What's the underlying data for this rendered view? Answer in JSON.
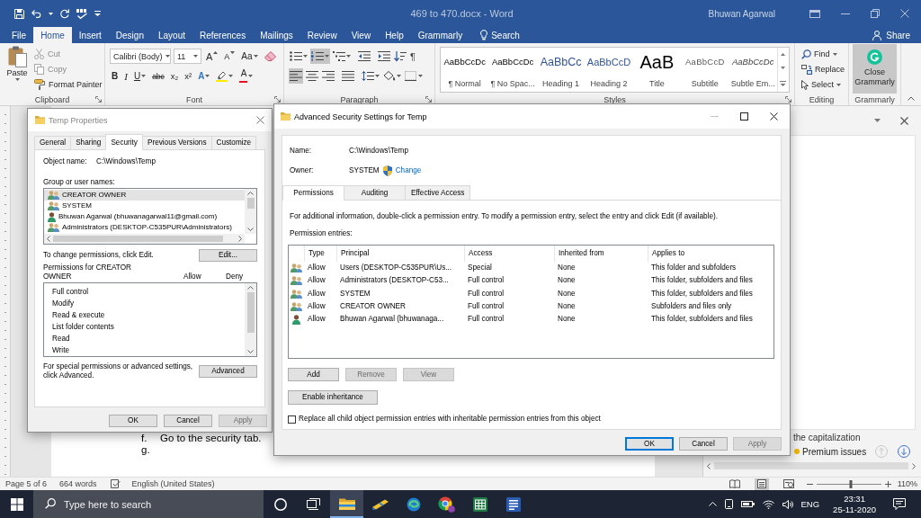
{
  "word": {
    "title": "469 to 470.docx - Word",
    "user": "Bhuwan Agarwal",
    "tabs": [
      {
        "label": "File",
        "selected": false
      },
      {
        "label": "Home",
        "selected": true
      },
      {
        "label": "Insert",
        "selected": false
      },
      {
        "label": "Design",
        "selected": false
      },
      {
        "label": "Layout",
        "selected": false
      },
      {
        "label": "References",
        "selected": false
      },
      {
        "label": "Mailings",
        "selected": false
      },
      {
        "label": "Review",
        "selected": false
      },
      {
        "label": "View",
        "selected": false
      },
      {
        "label": "Help",
        "selected": false
      },
      {
        "label": "Grammarly",
        "selected": false
      }
    ],
    "search": "Search",
    "share": "Share"
  },
  "ribbon": {
    "clipboard": {
      "label": "Clipboard",
      "paste": "Paste",
      "items": [
        {
          "kind": "cut",
          "label": "Cut",
          "disabled": true
        },
        {
          "kind": "copy",
          "label": "Copy",
          "disabled": true
        },
        {
          "kind": "painter",
          "label": "Format Painter",
          "disabled": false
        }
      ]
    },
    "font": {
      "label": "Font",
      "font_name": "Calibri (Body)",
      "font_size": "11",
      "tools": [
        {
          "kind": "grow",
          "label": "A"
        },
        {
          "kind": "shrink",
          "label": "A"
        },
        {
          "kind": "case",
          "label": "Aa"
        },
        {
          "kind": "clear"
        }
      ],
      "format": [
        {
          "kind": "bold",
          "label": "B"
        },
        {
          "kind": "italic",
          "label": "I"
        },
        {
          "kind": "underline",
          "label": "U"
        },
        {
          "kind": "strike",
          "label": "abc"
        },
        {
          "kind": "subscript",
          "label": "x₂"
        },
        {
          "kind": "superscript",
          "label": "x²"
        },
        {
          "kind": "effects",
          "label": "A"
        },
        {
          "kind": "highlight"
        },
        {
          "kind": "color",
          "label": "A"
        }
      ]
    },
    "paragraph": {
      "label": "Paragraph",
      "row1": [
        {
          "kind": "bullets",
          "selected": false
        },
        {
          "kind": "numbering",
          "selected": true
        },
        {
          "kind": "multilevel",
          "selected": false
        },
        {
          "kind": "outdent",
          "selected": false
        },
        {
          "kind": "indent",
          "selected": false
        },
        {
          "kind": "sort",
          "selected": false
        },
        {
          "kind": "marks",
          "label": "¶",
          "selected": false
        }
      ],
      "row2": [
        {
          "kind": "align_left",
          "selected": true
        },
        {
          "kind": "center",
          "selected": false
        },
        {
          "kind": "align_right",
          "selected": false
        },
        {
          "kind": "justify",
          "selected": false
        },
        {
          "kind": "spacing",
          "selected": false
        },
        {
          "kind": "shading",
          "selected": false
        },
        {
          "kind": "borders",
          "selected": false
        }
      ]
    },
    "styles": {
      "label": "Styles",
      "items": [
        {
          "kind": "normal",
          "preview": "AaBbCcDc",
          "name": "¶ Normal"
        },
        {
          "kind": "normal",
          "preview": "AaBbCcDc",
          "name": "¶ No Spac..."
        },
        {
          "kind": "heading1",
          "preview": "AaBbCc",
          "name": "Heading 1"
        },
        {
          "kind": "heading2",
          "preview": "AaBbCcD",
          "name": "Heading 2"
        },
        {
          "kind": "title",
          "preview": "AaB",
          "name": "Title"
        },
        {
          "kind": "subtitle",
          "preview": "AaBbCcD",
          "name": "Subtitle"
        },
        {
          "kind": "emphasis",
          "preview": "AaBbCcDc",
          "name": "Subtle Em..."
        }
      ]
    },
    "editing": {
      "label": "Editing",
      "items": [
        {
          "kind": "find",
          "label": "Find",
          "dropdown": true
        },
        {
          "kind": "replace",
          "label": "Replace",
          "dropdown": false
        },
        {
          "kind": "select",
          "label": "Select",
          "dropdown": true
        }
      ]
    },
    "grammarly": {
      "label": "Grammarly",
      "button": "Close Grammarly"
    }
  },
  "document": {
    "lines": [
      {
        "marker": "f.",
        "text": "Go to the security tab."
      },
      {
        "marker": "g."
      }
    ]
  },
  "side_pane": {
    "snippet": "the capitalization",
    "premium": "Premium issues"
  },
  "status_bar": {
    "page": "Page 5 of 6",
    "words": "664 words",
    "language": "English (United States)",
    "views": [
      {
        "kind": "read",
        "selected": false
      },
      {
        "kind": "print",
        "selected": true
      },
      {
        "kind": "web",
        "selected": false
      }
    ],
    "zoom": {
      "level": 0.53,
      "label": "110%"
    }
  },
  "taskbar": {
    "search": {
      "placeholder": "Type here to search"
    },
    "apps": [
      {
        "kind": "cortana",
        "selected": false
      },
      {
        "kind": "task_view",
        "selected": false
      },
      {
        "kind": "explorer",
        "selected": true
      },
      {
        "kind": "pen",
        "selected": false
      },
      {
        "kind": "edge",
        "selected": false
      },
      {
        "kind": "chrome",
        "selected": false
      },
      {
        "kind": "excel",
        "selected": false
      },
      {
        "kind": "word",
        "selected": false
      }
    ],
    "language": "ENG",
    "time": "23:31",
    "date": "25-11-2020"
  },
  "temp_properties": {
    "title": "Temp Properties",
    "active": false,
    "tabs": [
      {
        "label": "General",
        "selected": false
      },
      {
        "label": "Sharing",
        "selected": false
      },
      {
        "label": "Security",
        "selected": true
      },
      {
        "label": "Previous Versions",
        "selected": false
      },
      {
        "label": "Customize",
        "selected": false
      }
    ],
    "object_label": "Object name:",
    "object_value": "C:\\Windows\\Temp",
    "group_label": "Group or user names:",
    "principals": [
      {
        "kind": "group",
        "name": "CREATOR OWNER",
        "selected": true
      },
      {
        "kind": "group",
        "name": "SYSTEM",
        "selected": false
      },
      {
        "kind": "user",
        "name": "Bhuwan Agarwal (bhuwanagarwal11@gmail.com)",
        "selected": false
      },
      {
        "kind": "group",
        "name": "Administrators (DESKTOP-C535PUR\\Administrators)",
        "selected": false
      }
    ],
    "edit_hint": "To change permissions, click Edit.",
    "edit_button": "Edit...",
    "permissions_label": "Permissions for CREATOR OWNER",
    "allow": "Allow",
    "deny": "Deny",
    "permissions": [
      "Full control",
      "Modify",
      "Read & execute",
      "List folder contents",
      "Read",
      "Write"
    ],
    "advanced_hint": "For special permissions or advanced settings, click Advanced.",
    "advanced_button": "Advanced",
    "buttons": [
      {
        "label": "OK",
        "disabled": false
      },
      {
        "label": "Cancel",
        "disabled": false
      },
      {
        "label": "Apply",
        "disabled": true
      }
    ]
  },
  "advanced_security": {
    "title": "Advanced Security Settings for Temp",
    "active": true,
    "name_label": "Name:",
    "name_value": "C:\\Windows\\Temp",
    "owner_label": "Owner:",
    "owner_value": "SYSTEM",
    "change_link": "Change",
    "tabs": [
      {
        "label": "Permissions",
        "selected": true
      },
      {
        "label": "Auditing",
        "selected": false
      },
      {
        "label": "Effective Access",
        "selected": false
      }
    ],
    "info": "For additional information, double-click a permission entry. To modify a permission entry, select the entry and click Edit (if available).",
    "entries_label": "Permission entries:",
    "columns": [
      "Type",
      "Principal",
      "Access",
      "Inherited from",
      "Applies to"
    ],
    "entries": [
      {
        "kind": "group",
        "type": "Allow",
        "principal": "Users (DESKTOP-C535PUR\\Us...",
        "access": "Special",
        "inherited": "None",
        "applies_to": "This folder and subfolders"
      },
      {
        "kind": "group",
        "type": "Allow",
        "principal": "Administrators (DESKTOP-C53...",
        "access": "Full control",
        "inherited": "None",
        "applies_to": "This folder, subfolders and files"
      },
      {
        "kind": "group",
        "type": "Allow",
        "principal": "SYSTEM",
        "access": "Full control",
        "inherited": "None",
        "applies_to": "This folder, subfolders and files"
      },
      {
        "kind": "group",
        "type": "Allow",
        "principal": "CREATOR OWNER",
        "access": "Full control",
        "inherited": "None",
        "applies_to": "Subfolders and files only"
      },
      {
        "kind": "user",
        "type": "Allow",
        "principal": "Bhuwan Agarwal (bhuwanaga...",
        "access": "Full control",
        "inherited": "None",
        "applies_to": "This folder, subfolders and files"
      }
    ],
    "entry_buttons": [
      {
        "label": "Add",
        "disabled": false
      },
      {
        "label": "Remove",
        "disabled": true
      },
      {
        "label": "View",
        "disabled": true
      }
    ],
    "inheritance_button": "Enable inheritance",
    "replace": {
      "label": "Replace all child object permission entries with inheritable permission entries from this object",
      "checked": false
    },
    "buttons": [
      {
        "label": "OK",
        "default": true,
        "disabled": false
      },
      {
        "label": "Cancel",
        "default": false,
        "disabled": false
      },
      {
        "label": "Apply",
        "default": false,
        "disabled": true
      }
    ]
  }
}
